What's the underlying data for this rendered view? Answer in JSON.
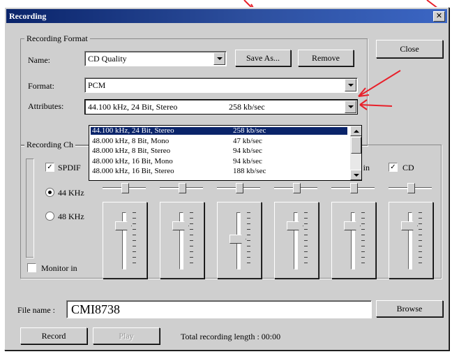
{
  "window": {
    "title": "Recording",
    "close_glyph": "✕"
  },
  "format_group": {
    "legend": "Recording Format",
    "name_label": "Name:",
    "name_value": "CD Quality",
    "save_as_label": "Save As...",
    "remove_label": "Remove",
    "format_label": "Format:",
    "format_value": "PCM",
    "attributes_label": "Attributes:",
    "attributes_value": "44.100 kHz, 24 Bit, Stereo",
    "attributes_rate": "258 kb/sec"
  },
  "close_button_label": "Close",
  "attributes_dropdown": {
    "items": [
      {
        "name": "44.100 kHz, 24 Bit, Stereo",
        "rate": "258 kb/sec",
        "selected": true
      },
      {
        "name": "48.000 kHz, 8 Bit, Mono",
        "rate": "47 kb/sec",
        "selected": false
      },
      {
        "name": "48.000 kHz, 8 Bit, Stereo",
        "rate": "94 kb/sec",
        "selected": false
      },
      {
        "name": "48.000 kHz, 16 Bit, Mono",
        "rate": "94 kb/sec",
        "selected": false
      },
      {
        "name": "48.000 kHz, 16 Bit, Stereo",
        "rate": "188 kb/sec",
        "selected": false
      }
    ]
  },
  "channel_group": {
    "legend": "Recording Ch",
    "spdif_label": "SPDIF",
    "spdif_checked": true,
    "rate_44_label": "44 KHz",
    "rate_44_selected": true,
    "rate_48_label": "48 KHz",
    "rate_48_selected": false,
    "monitor_label": "Monitor in",
    "monitor_checked": false,
    "line_in_label": "K in",
    "line_in_checked": true,
    "cd_label": "CD",
    "cd_checked": true,
    "faders": [
      {
        "name": "fader-1",
        "level": 0.82
      },
      {
        "name": "fader-2",
        "level": 0.82
      },
      {
        "name": "fader-3",
        "level": 0.55
      },
      {
        "name": "fader-4",
        "level": 0.82
      },
      {
        "name": "fader-5",
        "level": 0.82
      },
      {
        "name": "fader-6",
        "level": 0.82
      }
    ],
    "balances": [
      0.5,
      0.5,
      0.5,
      0.5,
      0.5,
      0.5
    ]
  },
  "file": {
    "label": "File name :",
    "value": "CMI8738",
    "browse_label": "Browse"
  },
  "footer": {
    "record_label": "Record",
    "play_label": "Play",
    "total_length_label": "Total recording length : 00:00"
  },
  "colors": {
    "selection": "#0a246a",
    "annotation_arrow": "#e8202a",
    "titlebar": "#0a246a"
  }
}
